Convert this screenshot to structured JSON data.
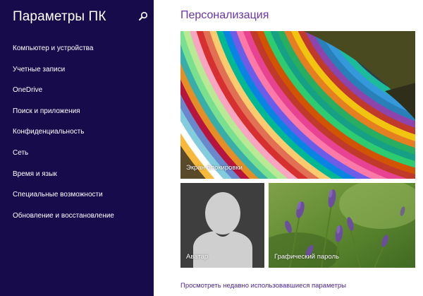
{
  "sidebar": {
    "title": "Параметры ПК",
    "search_icon": "search-icon",
    "items": [
      {
        "label": "Компьютер и устройства"
      },
      {
        "label": "Учетные записи"
      },
      {
        "label": "OneDrive"
      },
      {
        "label": "Поиск и приложения"
      },
      {
        "label": "Конфиденциальность"
      },
      {
        "label": "Сеть"
      },
      {
        "label": "Время и язык"
      },
      {
        "label": "Специальные возможности"
      },
      {
        "label": "Обновление и восстановление"
      }
    ]
  },
  "main": {
    "title": "Персонализация",
    "tiles": {
      "lock_screen": {
        "label": "Экран блокировки"
      },
      "avatar": {
        "label": "Аватар"
      },
      "picture_password": {
        "label": "Графический пароль"
      }
    },
    "recent_link": "Просмотреть недавно использовавшиеся параметры"
  },
  "colors": {
    "sidebar_bg": "#180b4b",
    "accent": "#6b35a8"
  }
}
